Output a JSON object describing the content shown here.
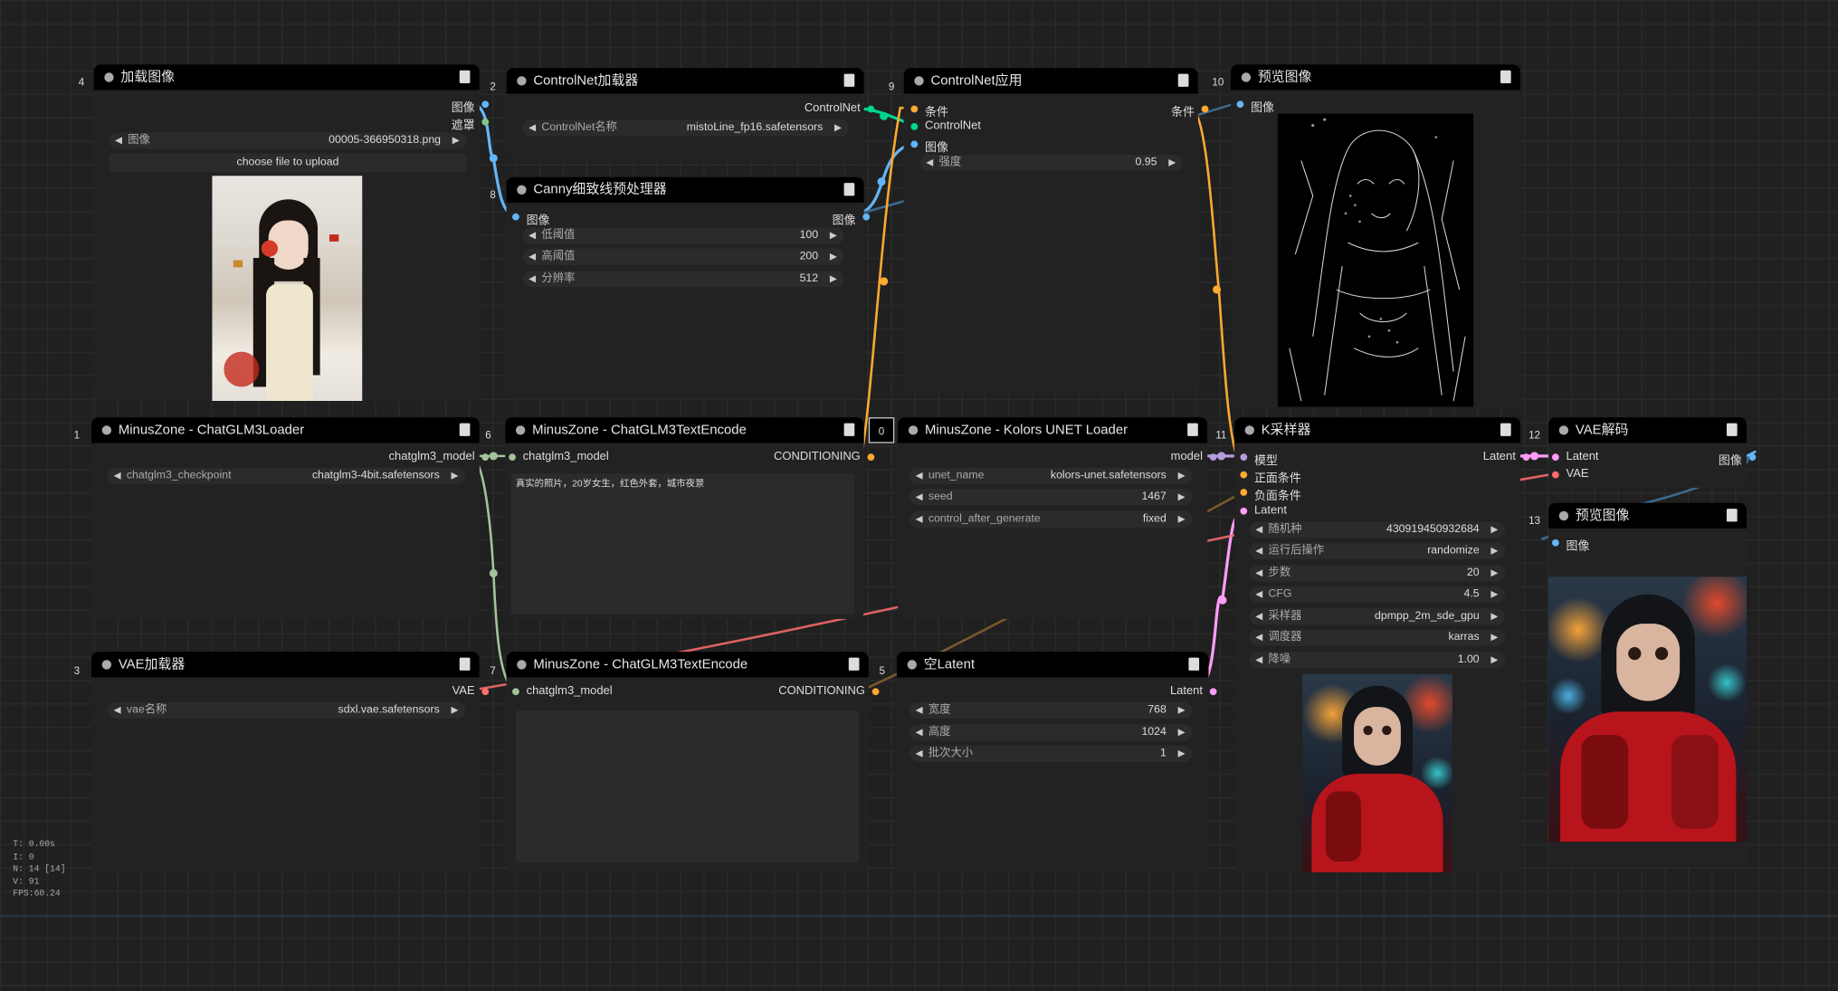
{
  "colors": {
    "image": "#64b5f6",
    "mask": "#81c784",
    "controlnet": "#00d78d",
    "conditioning": "#ffa931",
    "model": "#b39ddb",
    "clip": "#a4c39a",
    "vae": "#ff6e6e",
    "latent": "#ff9cf9"
  },
  "stats": {
    "t": "T: 0.00s",
    "i": "I: 0",
    "n": "N: 14 [14]",
    "v": "V: 91",
    "fps": "FPS:60.24"
  },
  "nodes": {
    "n4": {
      "id": "4",
      "title": "加载图像",
      "out_image": "图像",
      "out_mask": "遮罩",
      "widget_label": "图像",
      "widget_value": "00005-366950318.png",
      "upload": "choose file to upload"
    },
    "n2": {
      "id": "2",
      "title": "ControlNet加载器",
      "out": "ControlNet",
      "widget_label": "ControlNet名称",
      "widget_value": "mistoLine_fp16.safetensors"
    },
    "n8": {
      "id": "8",
      "title": "Canny细致线预处理器",
      "in": "图像",
      "out": "图像",
      "w1_label": "低阈值",
      "w1_value": "100",
      "w2_label": "高阈值",
      "w2_value": "200",
      "w3_label": "分辨率",
      "w3_value": "512"
    },
    "n9": {
      "id": "9",
      "title": "ControlNet应用",
      "in1": "条件",
      "in2": "ControlNet",
      "in3": "图像",
      "out": "条件",
      "w_label": "强度",
      "w_value": "0.95"
    },
    "n10": {
      "id": "10",
      "title": "预览图像",
      "in": "图像"
    },
    "n1": {
      "id": "1",
      "title": "MinusZone - ChatGLM3Loader",
      "out": "chatglm3_model",
      "w_label": "chatglm3_checkpoint",
      "w_value": "chatglm3-4bit.safetensors"
    },
    "n6": {
      "id": "6",
      "title": "MinusZone - ChatGLM3TextEncode",
      "in": "chatglm3_model",
      "out": "CONDITIONING",
      "text": "真实的照片，20岁女生，红色外套，城市夜景"
    },
    "n0": {
      "id": "0",
      "title": "MinusZone - Kolors UNET Loader",
      "out": "model",
      "w1_label": "unet_name",
      "w1_value": "kolors-unet.safetensors",
      "w2_label": "seed",
      "w2_value": "1467",
      "w3_label": "control_after_generate",
      "w3_value": "fixed"
    },
    "n11": {
      "id": "11",
      "title": "K采样器",
      "in1": "模型",
      "in2": "正面条件",
      "in3": "负面条件",
      "in4": "Latent",
      "out": "Latent",
      "w": [
        {
          "label": "随机种",
          "value": "430919450932684"
        },
        {
          "label": "运行后操作",
          "value": "randomize"
        },
        {
          "label": "步数",
          "value": "20"
        },
        {
          "label": "CFG",
          "value": "4.5"
        },
        {
          "label": "采样器",
          "value": "dpmpp_2m_sde_gpu"
        },
        {
          "label": "调度器",
          "value": "karras"
        },
        {
          "label": "降噪",
          "value": "1.00"
        }
      ]
    },
    "n12": {
      "id": "12",
      "title": "VAE解码",
      "in1": "Latent",
      "in2": "VAE",
      "out": "图像"
    },
    "n13": {
      "id": "13",
      "title": "预览图像",
      "in": "图像"
    },
    "n3": {
      "id": "3",
      "title": "VAE加载器",
      "out": "VAE",
      "w_label": "vae名称",
      "w_value": "sdxl.vae.safetensors"
    },
    "n7": {
      "id": "7",
      "title": "MinusZone - ChatGLM3TextEncode",
      "in": "chatglm3_model",
      "out": "CONDITIONING"
    },
    "n5": {
      "id": "5",
      "title": "空Latent",
      "out": "Latent",
      "w1_label": "宽度",
      "w1_value": "768",
      "w2_label": "高度",
      "w2_value": "1024",
      "w3_label": "批次大小",
      "w3_value": "1"
    }
  }
}
